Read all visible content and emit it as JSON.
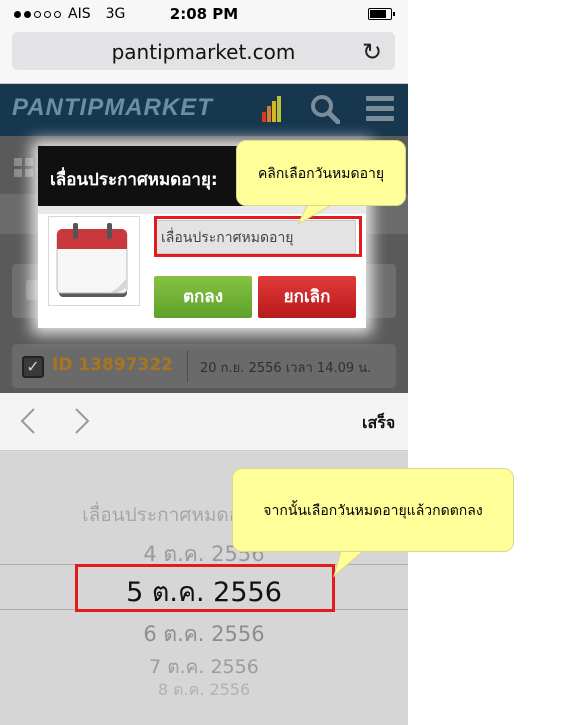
{
  "status_bar": {
    "carrier": "AIS",
    "network": "3G",
    "time": "2:08 PM"
  },
  "browser": {
    "url": "pantipmarket.com"
  },
  "site": {
    "logo": "PANTIPMARKET"
  },
  "background_listing": {
    "id_label": "ID 13897322",
    "datetime": "20 ก.ย. 2556 เวลา 14.09 น."
  },
  "modal": {
    "title": "เลื่อนประกาศหมดอายุ:",
    "reason_placeholder": "เลื่อนประกาศหมดอายุ",
    "ok_label": "ตกลง",
    "cancel_label": "ยกเลิก"
  },
  "picker": {
    "done_label": "เสร็จ",
    "options": [
      "เลื่อนประกาศหมดอายุ",
      "4 ต.ค. 2556",
      "5 ต.ค. 2556",
      "6 ต.ค. 2556",
      "7 ต.ค. 2556",
      "8 ต.ค. 2556"
    ],
    "selected": "5 ต.ค. 2556"
  },
  "callouts": {
    "select_expiry": "คลิกเลือกวันหมดอายุ",
    "then_select_and_ok": "จากนั้นเลือกวันหมดอายุแล้วกดตกลง"
  },
  "colors": {
    "highlight": "#e31b1b",
    "callout_fill": "#ffff99",
    "ok_button": "#6fb034",
    "cancel_button": "#cc2626",
    "site_header": "#17374f"
  }
}
